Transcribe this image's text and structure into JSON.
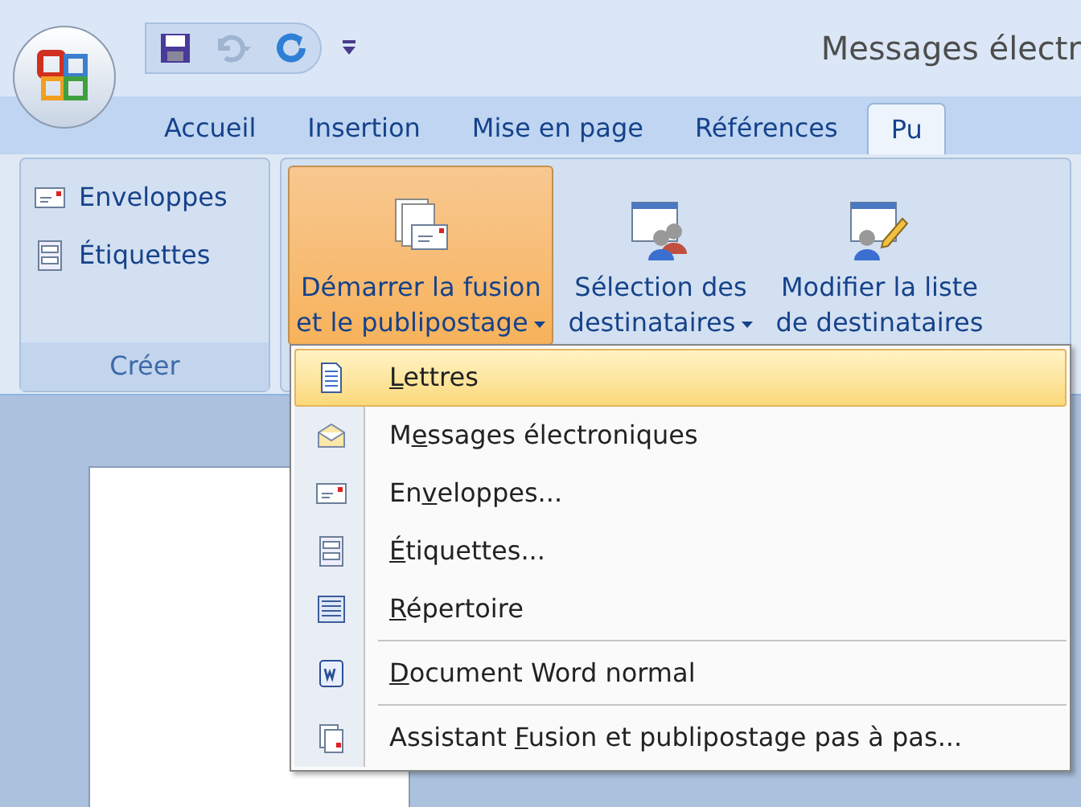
{
  "window": {
    "title": "Messages électr"
  },
  "tabs": [
    {
      "label": "Accueil",
      "selected": false
    },
    {
      "label": "Insertion",
      "selected": false
    },
    {
      "label": "Mise en page",
      "selected": false
    },
    {
      "label": "Références",
      "selected": false
    },
    {
      "label": "Pu",
      "selected": true
    }
  ],
  "ribbon": {
    "groups": [
      {
        "kind": "small",
        "label": "Créer",
        "buttons": [
          {
            "label": "Enveloppes"
          },
          {
            "label": "Étiquettes"
          }
        ]
      },
      {
        "kind": "large",
        "buttons": [
          {
            "line1": "Démarrer la fusion",
            "line2": "et le publipostage",
            "dropdown": true,
            "pressed": true
          },
          {
            "line1": "Sélection des",
            "line2": "destinataires",
            "dropdown": true,
            "pressed": false
          },
          {
            "line1": "Modifier la liste",
            "line2": "de destinataires",
            "dropdown": false,
            "pressed": false
          }
        ]
      }
    ]
  },
  "menu": {
    "items": [
      {
        "key": "L",
        "after": "ettres",
        "selected": true,
        "separator_before": false
      },
      {
        "before": "M",
        "key": "e",
        "after": "ssages électroniques",
        "selected": false,
        "separator_before": false
      },
      {
        "before": "En",
        "key": "v",
        "after": "eloppes...",
        "selected": false,
        "separator_before": false
      },
      {
        "key": "É",
        "after": "tiquettes...",
        "selected": false,
        "separator_before": false
      },
      {
        "key": "R",
        "after": "épertoire",
        "selected": false,
        "separator_before": false
      },
      {
        "key": "D",
        "after": "ocument Word normal",
        "selected": false,
        "separator_before": true
      },
      {
        "before": "Assistant ",
        "key": "F",
        "after": "usion et publipostage pas à pas...",
        "selected": false,
        "separator_before": true
      }
    ]
  }
}
